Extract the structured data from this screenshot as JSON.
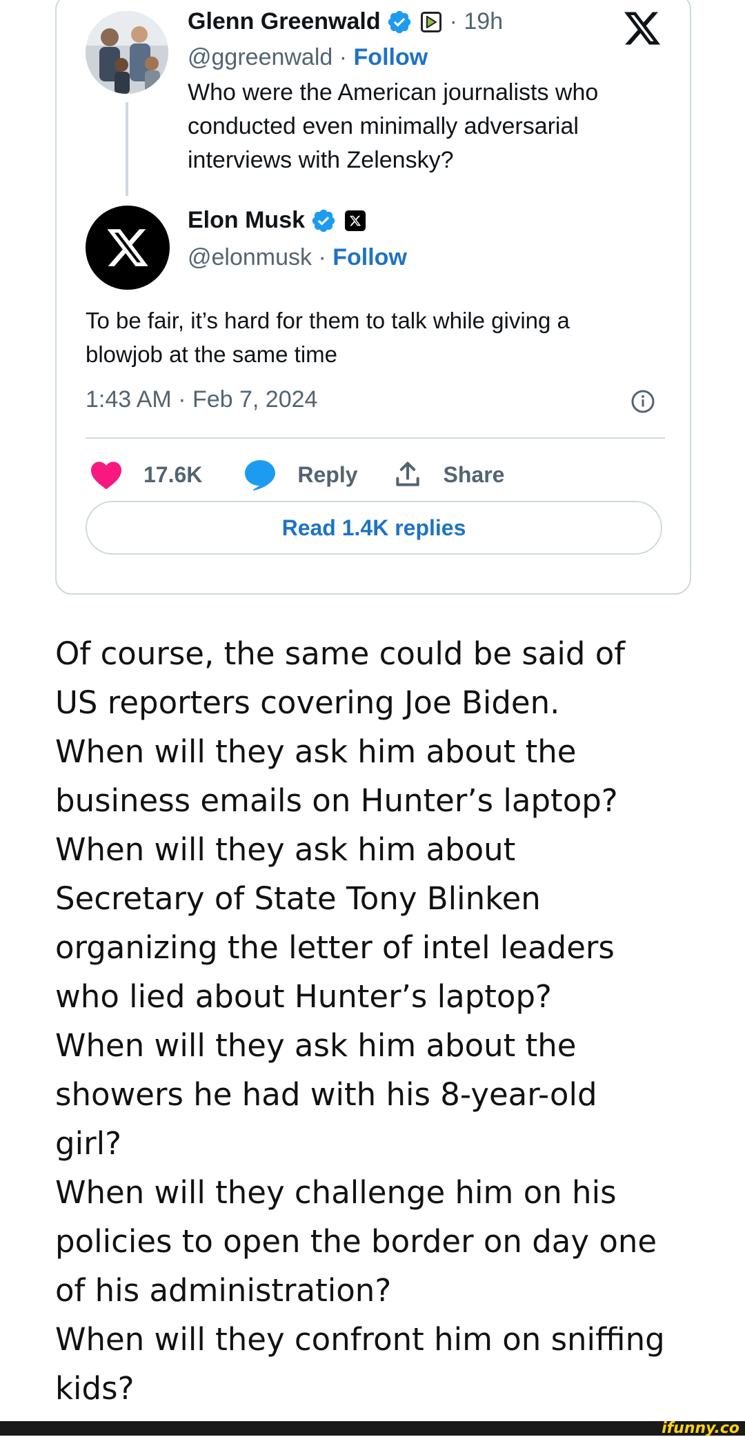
{
  "tweet": {
    "parent": {
      "name": "Glenn Greenwald",
      "time": "· 19h",
      "handle": "@ggreenwald ·",
      "follow_label": "Follow",
      "text_lines": [
        "Who were the American journalists who",
        "conducted even minimally adversarial",
        "interviews with Zelensky?"
      ]
    },
    "reply": {
      "name": "Elon Musk",
      "handle": "@elonmusk ·",
      "follow_label": "Follow",
      "text_lines": [
        "To be fair, it’s hard for them to talk while giving a",
        "blowjob at the same time"
      ]
    },
    "timestamp": "1:43 AM · Feb 7, 2024",
    "likes": "17.6K",
    "reply_label": "Reply",
    "share_label": "Share",
    "read_replies_label": "Read 1.4K replies",
    "colors": {
      "like": "#f91880",
      "reply": "#1d9bf0",
      "link": "#1d73c6",
      "verified": "#1d9bf0"
    },
    "icons": [
      "verified-badge-icon",
      "rumble-icon",
      "x-logo-icon",
      "info-icon",
      "heart-icon",
      "speech-bubble-icon",
      "share-icon"
    ]
  },
  "caption_lines": [
    "Of course, the same could be said of",
    "US reporters covering Joe Biden.",
    "When will they ask him about the",
    "business emails on Hunter’s laptop?",
    "When will they ask him about",
    "Secretary of State Tony Blinken",
    "organizing the letter of intel leaders",
    "who lied about Hunter’s laptop?",
    "When will they ask him about the",
    "showers he had with his 8-year-old",
    "girl?",
    "When will they challenge him on his",
    "policies to open the border on day one",
    "of his administration?",
    "When will they confront him on sniffing",
    "kids?"
  ],
  "watermark": "ifunny.co"
}
